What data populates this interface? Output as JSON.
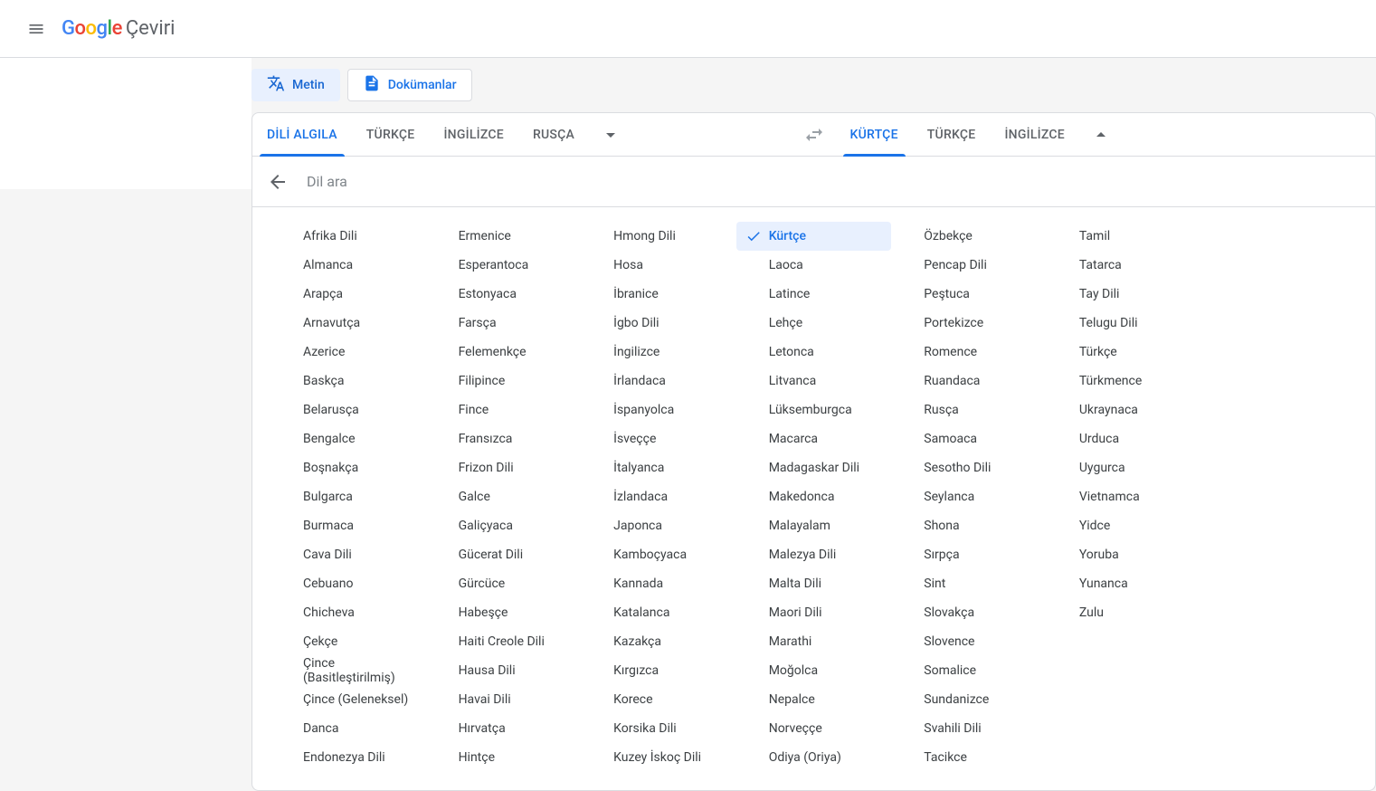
{
  "header": {
    "app_name": "Google",
    "app_subtitle": "Çeviri"
  },
  "toolbar": {
    "text_btn": "Metin",
    "docs_btn": "Dokümanlar"
  },
  "source_tabs": {
    "detect": "DİLİ ALGILA",
    "tab1": "TÜRKÇE",
    "tab2": "İNGİLİZCE",
    "tab3": "RUSÇA"
  },
  "target_tabs": {
    "tab1": "KÜRTÇE",
    "tab2": "TÜRKÇE",
    "tab3": "İNGİLİZCE"
  },
  "search": {
    "placeholder": "Dil ara"
  },
  "selected_language": "Kürtçe",
  "languages": [
    "Afrika Dili",
    "Almanca",
    "Arapça",
    "Arnavutça",
    "Azerice",
    "Baskça",
    "Belarusça",
    "Bengalce",
    "Boşnakça",
    "Bulgarca",
    "Burmaca",
    "Cava Dili",
    "Cebuano",
    "Chicheva",
    "Çekçe",
    "Çince (Basitleştirilmiş)",
    "Çince (Geleneksel)",
    "Danca",
    "Endonezya Dili",
    "Ermenice",
    "Esperantoca",
    "Estonyaca",
    "Farsça",
    "Felemenkçe",
    "Filipince",
    "Fince",
    "Fransızca",
    "Frizon Dili",
    "Galce",
    "Galiçyaca",
    "Gücerat Dili",
    "Gürcüce",
    "Habeşçe",
    "Haiti Creole Dili",
    "Hausa Dili",
    "Havai Dili",
    "Hırvatça",
    "Hintçe",
    "Hmong Dili",
    "Hosa",
    "İbranice",
    "İgbo Dili",
    "İngilizce",
    "İrlandaca",
    "İspanyolca",
    "İsveççe",
    "İtalyanca",
    "İzlandaca",
    "Japonca",
    "Kamboçyaca",
    "Kannada",
    "Katalanca",
    "Kazakça",
    "Kırgızca",
    "Korece",
    "Korsika Dili",
    "Kuzey İskoç Dili",
    "Kürtçe",
    "Laoca",
    "Latince",
    "Lehçe",
    "Letonca",
    "Litvanca",
    "Lüksemburgca",
    "Macarca",
    "Madagaskar Dili",
    "Makedonca",
    "Malayalam",
    "Malezya Dili",
    "Malta Dili",
    "Maori Dili",
    "Marathi",
    "Moğolca",
    "Nepalce",
    "Norveççe",
    "Odiya (Oriya)",
    "Özbekçe",
    "Pencap Dili",
    "Peştuca",
    "Portekizce",
    "Romence",
    "Ruandaca",
    "Rusça",
    "Samoaca",
    "Sesotho Dili",
    "Seylanca",
    "Shona",
    "Sırpça",
    "Sint",
    "Slovakça",
    "Slovence",
    "Somalice",
    "Sundanizce",
    "Svahili Dili",
    "Tacikce",
    "Tamil",
    "Tatarca",
    "Tay Dili",
    "Telugu Dili",
    "Türkçe",
    "Türkmence",
    "Ukraynaca",
    "Urduca",
    "Uygurca",
    "Vietnamca",
    "Yidce",
    "Yoruba",
    "Yunanca",
    "Zulu"
  ]
}
